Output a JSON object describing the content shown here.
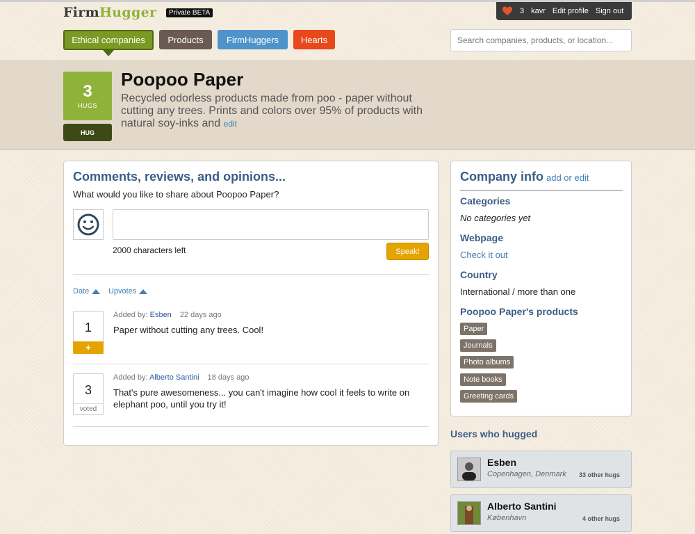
{
  "header": {
    "logo_firm": "Firm",
    "logo_hugger": "Hugger",
    "beta_badge": "Private BETA",
    "user": {
      "heart_count": "3",
      "username": "kavr",
      "edit_profile": "Edit profile",
      "sign_out": "Sign out"
    },
    "nav": {
      "ethical": "Ethical companies",
      "products": "Products",
      "firmhuggers": "FirmHuggers",
      "hearts": "Hearts"
    },
    "search_placeholder": "Search companies, products, or location..."
  },
  "company": {
    "hugs_count": "3",
    "hugs_label": "HUGS",
    "hug_button": "HUG",
    "name": "Poopoo Paper",
    "description": "Recycled odorless products made from poo - paper without cutting any trees. Prints and colors over 95% of products with natural soy-inks and",
    "edit_link": "edit"
  },
  "comments": {
    "title": "Comments, reviews, and opinions...",
    "question": "What would you like to share about Poopoo Paper?",
    "chars_left": "2000 characters left",
    "speak_button": "Speak!",
    "sort_date": "Date",
    "sort_upvotes": "Upvotes",
    "items": [
      {
        "votes": "1",
        "vote_action": "+",
        "added_by_label": "Added by:",
        "author": "Esben",
        "time": "22 days ago",
        "text": "Paper without cutting any trees. Cool!"
      },
      {
        "votes": "3",
        "vote_action": "voted",
        "added_by_label": "Added by:",
        "author": "Alberto Santini",
        "time": "18 days ago",
        "text": "That's pure awesomeness... you can't imagine how cool it feels to write on elephant poo, until you try it!"
      }
    ]
  },
  "company_info": {
    "title": "Company info",
    "add_edit": "add or edit",
    "categories_label": "Categories",
    "categories_value": "No categories yet",
    "webpage_label": "Webpage",
    "webpage_link": "Check it out",
    "country_label": "Country",
    "country_value": "International / more than one",
    "products_label": "Poopoo Paper's products",
    "products": [
      "Paper",
      "Journals",
      "Photo albums",
      "Note books",
      "Greeting cards"
    ]
  },
  "users_hugged": {
    "title": "Users who hugged",
    "users": [
      {
        "name": "Esben",
        "location": "Copenhagen, Denmark",
        "other_hugs": "33 other hugs"
      },
      {
        "name": "Alberto Santini",
        "location": "København",
        "other_hugs": "4 other hugs"
      }
    ]
  },
  "colors": {
    "green": "#8fb33a",
    "blue_heading": "#3b5e86",
    "link": "#3f7fb6",
    "orange_button": "#e4a400",
    "hearts_nav": "#e8481b"
  }
}
